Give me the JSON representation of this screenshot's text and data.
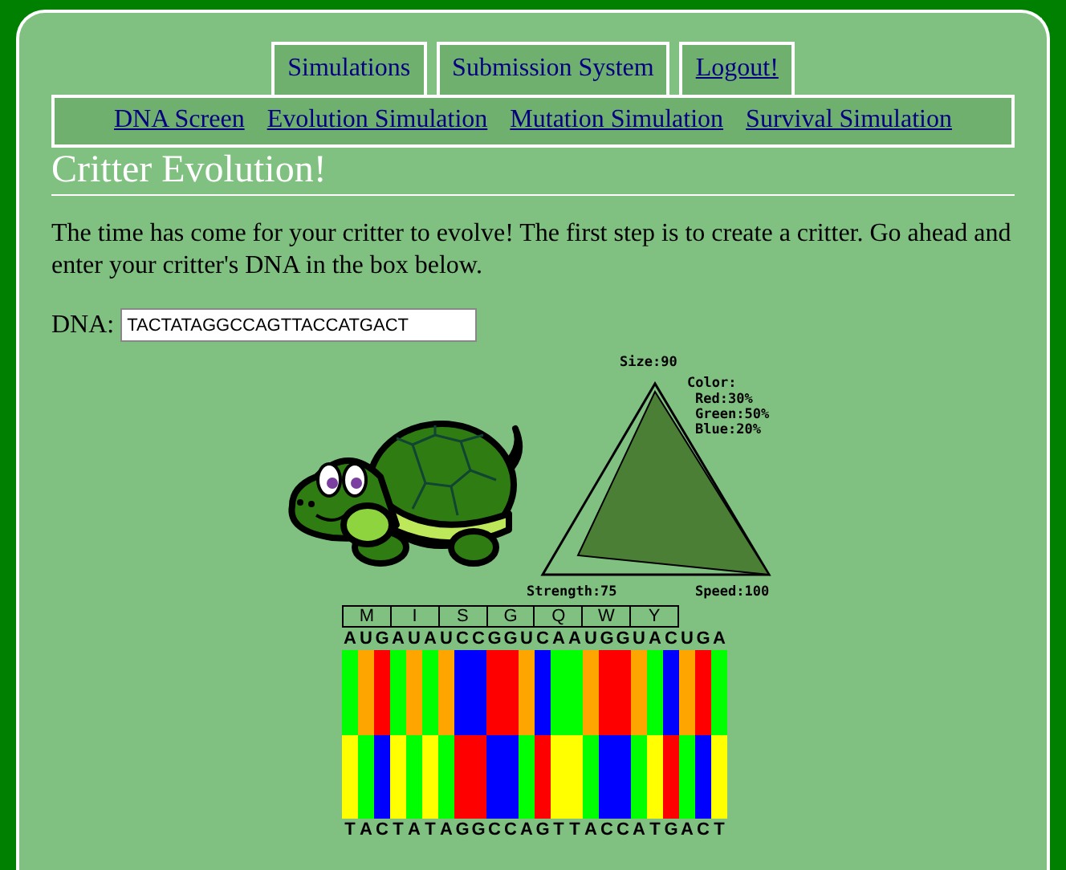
{
  "tabs": [
    {
      "label": "Simulations",
      "kind": "tab"
    },
    {
      "label": "Submission System",
      "kind": "tab"
    },
    {
      "label": "Logout!",
      "kind": "link"
    }
  ],
  "subnav": [
    "DNA Screen",
    "Evolution Simulation",
    "Mutation Simulation",
    "Survival Simulation"
  ],
  "heading": "Critter Evolution!",
  "intro": "The time has come for your critter to evolve! The first step is to create a critter. Go ahead and enter your critter's DNA in the box below.",
  "dna_field": {
    "label": "DNA:",
    "value": "TACTATAGGCCAGTTACCATGACT"
  },
  "stats": {
    "size": {
      "label": "Size:90"
    },
    "strength": {
      "label": "Strength:75"
    },
    "speed": {
      "label": "Speed:100"
    },
    "color_title": "Color:",
    "colors": [
      "Red:30%",
      "Green:50%",
      "Blue:20%"
    ]
  },
  "codons": [
    "M",
    "I",
    "S",
    "G",
    "Q",
    "W",
    "Y"
  ],
  "strand_columns": [
    {
      "top": {
        "base": "A",
        "color": "#00ff00"
      },
      "bottom": {
        "base": "T",
        "color": "#ffff00"
      }
    },
    {
      "top": {
        "base": "U",
        "color": "#ffa500"
      },
      "bottom": {
        "base": "A",
        "color": "#00ff00"
      }
    },
    {
      "top": {
        "base": "G",
        "color": "#ff0000"
      },
      "bottom": {
        "base": "C",
        "color": "#0000ff"
      }
    },
    {
      "top": {
        "base": "A",
        "color": "#00ff00"
      },
      "bottom": {
        "base": "T",
        "color": "#ffff00"
      }
    },
    {
      "top": {
        "base": "U",
        "color": "#ffa500"
      },
      "bottom": {
        "base": "A",
        "color": "#00ff00"
      }
    },
    {
      "top": {
        "base": "A",
        "color": "#00ff00"
      },
      "bottom": {
        "base": "T",
        "color": "#ffff00"
      }
    },
    {
      "top": {
        "base": "U",
        "color": "#ffa500"
      },
      "bottom": {
        "base": "A",
        "color": "#00ff00"
      }
    },
    {
      "top": {
        "base": "C",
        "color": "#0000ff"
      },
      "bottom": {
        "base": "G",
        "color": "#ff0000"
      }
    },
    {
      "top": {
        "base": "C",
        "color": "#0000ff"
      },
      "bottom": {
        "base": "G",
        "color": "#ff0000"
      }
    },
    {
      "top": {
        "base": "G",
        "color": "#ff0000"
      },
      "bottom": {
        "base": "C",
        "color": "#0000ff"
      }
    },
    {
      "top": {
        "base": "G",
        "color": "#ff0000"
      },
      "bottom": {
        "base": "C",
        "color": "#0000ff"
      }
    },
    {
      "top": {
        "base": "U",
        "color": "#ffa500"
      },
      "bottom": {
        "base": "A",
        "color": "#00ff00"
      }
    },
    {
      "top": {
        "base": "C",
        "color": "#0000ff"
      },
      "bottom": {
        "base": "G",
        "color": "#ff0000"
      }
    },
    {
      "top": {
        "base": "A",
        "color": "#00ff00"
      },
      "bottom": {
        "base": "T",
        "color": "#ffff00"
      }
    },
    {
      "top": {
        "base": "A",
        "color": "#00ff00"
      },
      "bottom": {
        "base": "T",
        "color": "#ffff00"
      }
    },
    {
      "top": {
        "base": "U",
        "color": "#ffa500"
      },
      "bottom": {
        "base": "A",
        "color": "#00ff00"
      }
    },
    {
      "top": {
        "base": "G",
        "color": "#ff0000"
      },
      "bottom": {
        "base": "C",
        "color": "#0000ff"
      }
    },
    {
      "top": {
        "base": "G",
        "color": "#ff0000"
      },
      "bottom": {
        "base": "C",
        "color": "#0000ff"
      }
    },
    {
      "top": {
        "base": "U",
        "color": "#ffa500"
      },
      "bottom": {
        "base": "A",
        "color": "#00ff00"
      }
    },
    {
      "top": {
        "base": "A",
        "color": "#00ff00"
      },
      "bottom": {
        "base": "T",
        "color": "#ffff00"
      }
    },
    {
      "top": {
        "base": "C",
        "color": "#0000ff"
      },
      "bottom": {
        "base": "G",
        "color": "#ff0000"
      }
    },
    {
      "top": {
        "base": "U",
        "color": "#ffa500"
      },
      "bottom": {
        "base": "A",
        "color": "#00ff00"
      }
    },
    {
      "top": {
        "base": "G",
        "color": "#ff0000"
      },
      "bottom": {
        "base": "C",
        "color": "#0000ff"
      }
    },
    {
      "top": {
        "base": "A",
        "color": "#00ff00"
      },
      "bottom": {
        "base": "T",
        "color": "#ffff00"
      }
    }
  ]
}
